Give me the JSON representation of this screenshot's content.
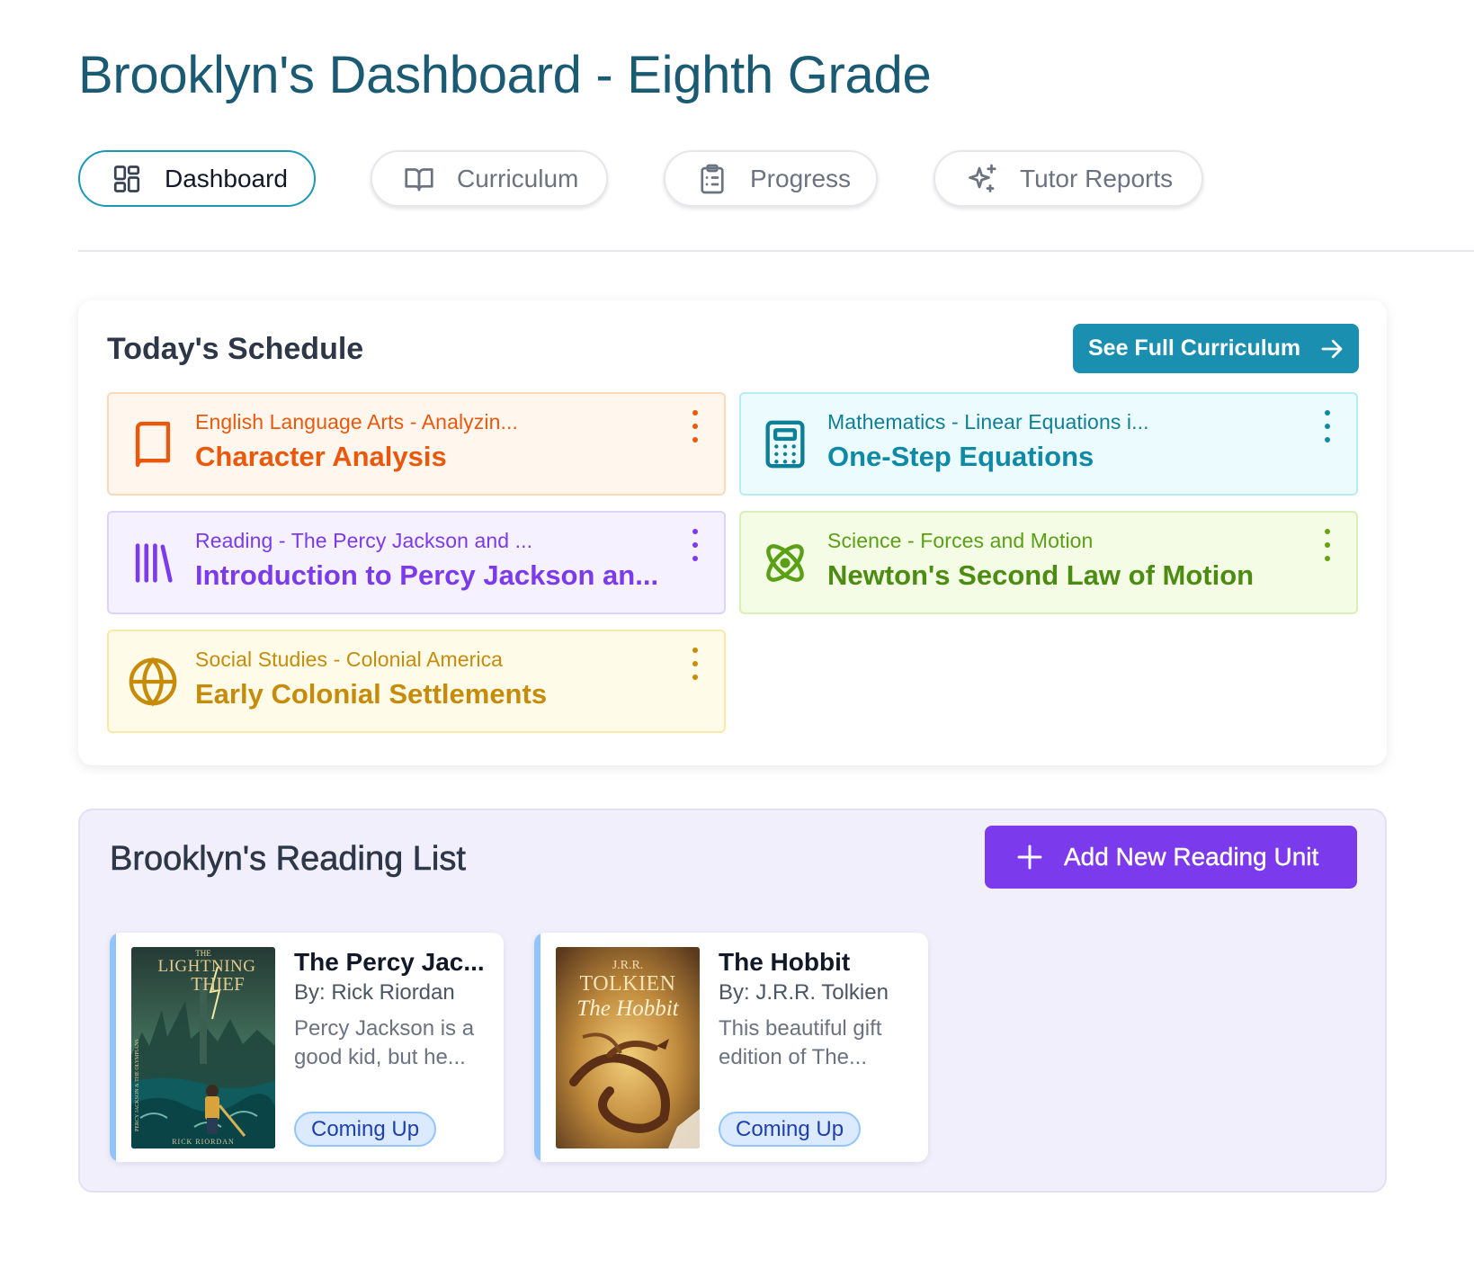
{
  "page": {
    "title": "Brooklyn's Dashboard - Eighth Grade"
  },
  "nav": {
    "tabs": [
      {
        "label": "Dashboard",
        "icon": "dashboard-grid-icon",
        "active": true
      },
      {
        "label": "Curriculum",
        "icon": "book-open-icon",
        "active": false
      },
      {
        "label": "Progress",
        "icon": "clipboard-icon",
        "active": false
      },
      {
        "label": "Tutor Reports",
        "icon": "sparkles-icon",
        "active": false
      }
    ]
  },
  "schedule": {
    "title": "Today's Schedule",
    "see_full_label": "See Full Curriculum",
    "lessons": [
      {
        "subject": "English Language Arts - Analyzin...",
        "title": "Character Analysis",
        "icon": "book-icon",
        "color": "#ea580c"
      },
      {
        "subject": "Mathematics - Linear Equations i...",
        "title": "One-Step Equations",
        "icon": "calculator-icon",
        "color": "#0e8aa6"
      },
      {
        "subject": "Reading - The Percy Jackson and ...",
        "title": "Introduction to Percy Jackson an...",
        "icon": "library-icon",
        "color": "#7c3aed"
      },
      {
        "subject": "Science - Forces and Motion",
        "title": "Newton's Second Law of Motion",
        "icon": "atom-icon",
        "color": "#65a30d"
      },
      {
        "subject": "Social Studies - Colonial America",
        "title": "Early Colonial Settlements",
        "icon": "globe-icon",
        "color": "#ca8a04"
      }
    ]
  },
  "reading": {
    "title": "Brooklyn's Reading List",
    "add_label": "Add New Reading Unit",
    "books": [
      {
        "title": "The Percy Jac...",
        "author": "By: Rick Riordan",
        "description": "Percy Jackson is a good kid, but he...",
        "status": "Coming Up",
        "cover_top": "THE",
        "cover_title_1": "LIGHTNING",
        "cover_title_2": "THIEF",
        "cover_author": "RICK RIORDAN",
        "cover_spine": "PERCY JACKSON & THE OLYMPIANS"
      },
      {
        "title": "The Hobbit",
        "author": "By: J.R.R. Tolkien",
        "description": "This beautiful gift edition of The...",
        "status": "Coming Up",
        "cover_top": "J.R.R.",
        "cover_title_1": "TOLKIEN",
        "cover_title_2": "The Hobbit",
        "cover_author": "",
        "cover_spine": ""
      }
    ]
  },
  "colors": {
    "brand_teal": "#1b8fb0",
    "brand_purple": "#7c3aed",
    "title_teal": "#1a5a73"
  }
}
